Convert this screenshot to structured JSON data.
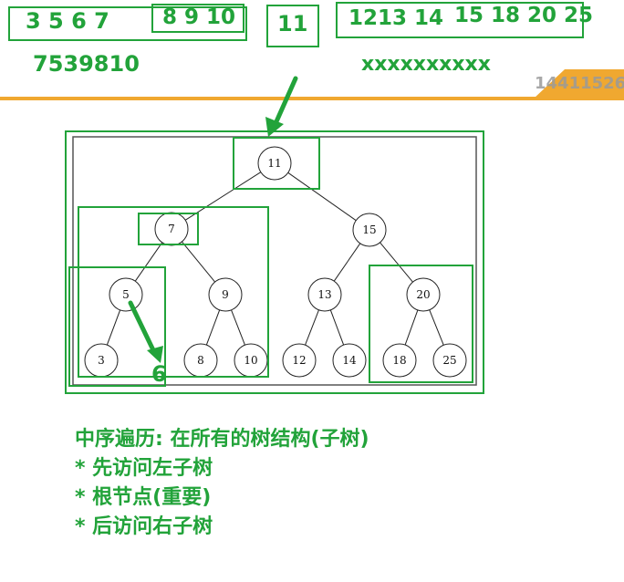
{
  "header": {
    "seq_left": "3 5 6  7",
    "seq_mid": "8 9 10",
    "root_value": "11",
    "seq_right_a": "1213 14",
    "seq_right_b": "15 18 20  25",
    "answer": "7539810",
    "mask": "xxxxxxxxxx",
    "watermark": "14411526"
  },
  "tree": {
    "nodes": [
      {
        "id": "n11",
        "label": "11"
      },
      {
        "id": "n7",
        "label": "7"
      },
      {
        "id": "n15",
        "label": "15"
      },
      {
        "id": "n5",
        "label": "5"
      },
      {
        "id": "n9",
        "label": "9"
      },
      {
        "id": "n13",
        "label": "13"
      },
      {
        "id": "n20",
        "label": "20"
      },
      {
        "id": "n3",
        "label": "3"
      },
      {
        "id": "n8",
        "label": "8"
      },
      {
        "id": "n10",
        "label": "10"
      },
      {
        "id": "n12",
        "label": "12"
      },
      {
        "id": "n14",
        "label": "14"
      },
      {
        "id": "n18",
        "label": "18"
      },
      {
        "id": "n25",
        "label": "25"
      }
    ],
    "edges": [
      [
        "n11",
        "n7"
      ],
      [
        "n11",
        "n15"
      ],
      [
        "n7",
        "n5"
      ],
      [
        "n7",
        "n9"
      ],
      [
        "n15",
        "n13"
      ],
      [
        "n15",
        "n20"
      ],
      [
        "n5",
        "n3"
      ],
      [
        "n9",
        "n8"
      ],
      [
        "n9",
        "n10"
      ],
      [
        "n13",
        "n12"
      ],
      [
        "n13",
        "n14"
      ],
      [
        "n20",
        "n18"
      ],
      [
        "n20",
        "n25"
      ]
    ],
    "annotation": "6"
  },
  "notes": {
    "line1": "中序遍历: 在所有的树结构(子树)",
    "line2": "* 先访问左子树",
    "line3": "* 根节点(重要)",
    "line4": "* 后访问右子树"
  },
  "colors": {
    "annotation_green": "#22a33a",
    "rule_orange": "#f0a830",
    "node_stroke": "#222222"
  }
}
